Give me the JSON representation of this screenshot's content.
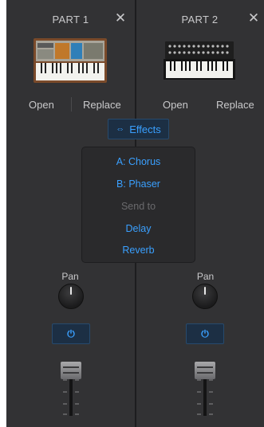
{
  "parts": [
    {
      "title": "PART 1",
      "close": "✕",
      "open_label": "Open",
      "replace_label": "Replace",
      "pan_label": "Pan",
      "power_icon": "power-icon"
    },
    {
      "title": "PART 2",
      "close": "✕",
      "open_label": "Open",
      "replace_label": "Replace",
      "pan_label": "Pan",
      "power_icon": "power-icon"
    }
  ],
  "effects": {
    "button_label": "Effects",
    "icon": "link-icon",
    "menu": [
      {
        "label": "A: Chorus",
        "enabled": true
      },
      {
        "label": "B: Phaser",
        "enabled": true
      },
      {
        "label": "Send to",
        "enabled": false
      },
      {
        "label": "Delay",
        "enabled": true
      },
      {
        "label": "Reverb",
        "enabled": true
      }
    ]
  },
  "colors": {
    "panel": "#323234",
    "accent": "#3aa0ff",
    "text": "#c9c9cb",
    "disabled": "#6a6a6d"
  }
}
